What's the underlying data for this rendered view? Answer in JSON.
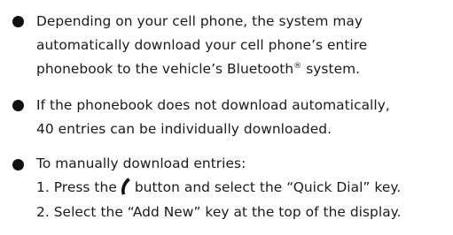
{
  "bullets": [
    {
      "lines": [
        "Depending on your cell phone, the system may",
        "automatically download your cell phone’s entire",
        "phonebook to the vehicle’s Bluetooth",
        " system."
      ],
      "trademark": "®"
    },
    {
      "lines": [
        "If the phonebook does not download automatically,",
        "40 entries can be individually downloaded."
      ]
    },
    {
      "lines": [
        "To manually download entries:"
      ]
    }
  ],
  "steps": [
    {
      "prefix": "1. Press the",
      "suffix": "button and select the “Quick Dial” key.",
      "icon": "phone-handset-icon"
    },
    {
      "text": "2.  Select the “Add New” key at the top of the display."
    }
  ]
}
